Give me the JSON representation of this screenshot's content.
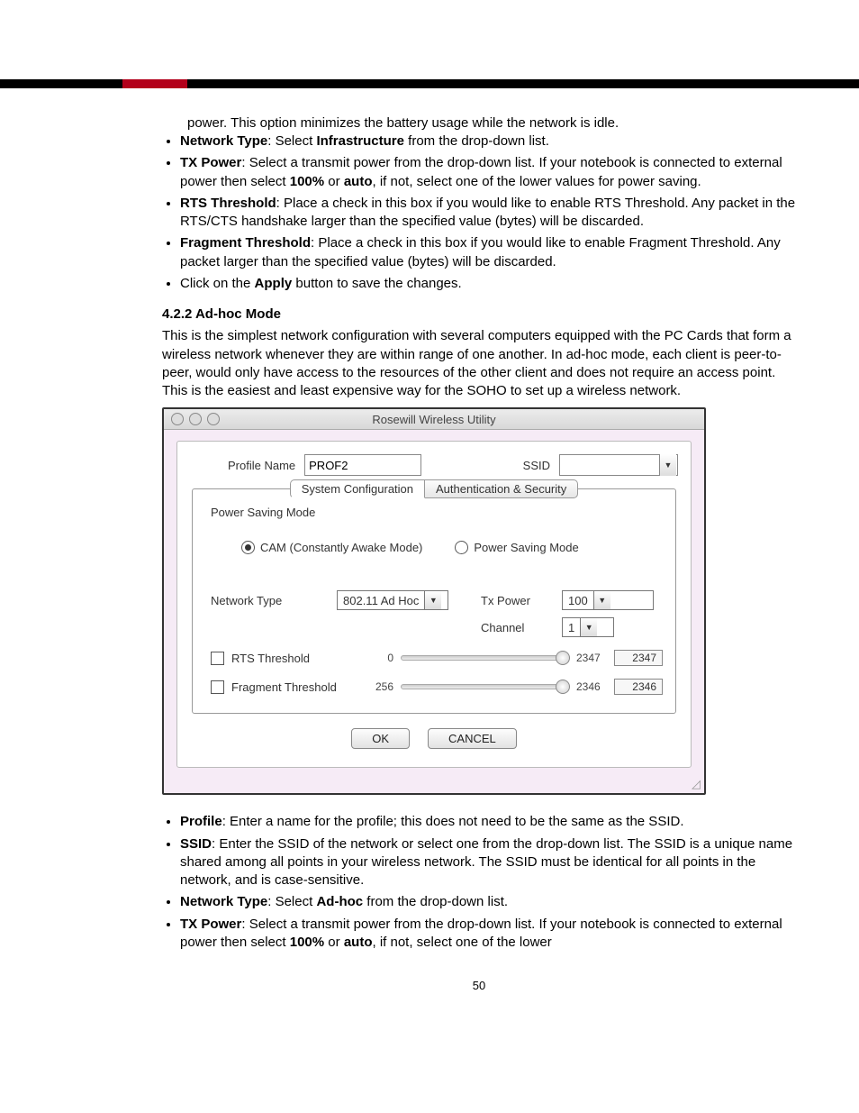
{
  "topText": {
    "powerLine": "power. This option minimizes the battery usage while the network is idle.",
    "bullets": [
      {
        "boldLead": "Network Type",
        "rest": ": Select ",
        "bold2": "Infrastructure",
        "tail": " from the drop-down list."
      },
      {
        "boldLead": "TX Power",
        "rest": ": Select a transmit power from the drop-down list. If your notebook is connected to external power then select ",
        "bold2": "100%",
        "mid": " or ",
        "bold3": "auto",
        "tail": ", if not, select one of the lower values for power saving."
      },
      {
        "boldLead": "RTS Threshold",
        "rest": ": Place a check in this box if you would like to enable RTS Threshold. Any packet in the RTS/CTS handshake larger than the specified value (bytes) will be discarded."
      },
      {
        "boldLead": "Fragment Threshold",
        "rest": ": Place a check in this box if you would like to enable Fragment Threshold. Any packet larger than the specified value (bytes) will be discarded."
      },
      {
        "plainLead": "Click on the ",
        "bold2": "Apply",
        "tail": " button to save the changes."
      }
    ]
  },
  "section": {
    "title": "4.2.2 Ad-hoc Mode",
    "para": "This is the simplest network configuration with several computers equipped with the PC Cards that form a wireless network whenever they are within range of one another.  In ad-hoc mode, each client is peer-to-peer, would only have access to the resources of the other client and does not require an access point. This is the easiest and least expensive way for the SOHO to set up a wireless network."
  },
  "shot": {
    "windowTitle": "Rosewill Wireless Utility",
    "profileNameLabel": "Profile Name",
    "profileNameValue": "PROF2",
    "ssidLabel": "SSID",
    "ssidValue": "",
    "tabs": {
      "sysconf": "System Configuration",
      "auth": "Authentication & Security"
    },
    "powerSavingHead": "Power Saving Mode",
    "radioCam": "CAM (Constantly Awake Mode)",
    "radioPsm": "Power Saving Mode",
    "networkTypeLabel": "Network Type",
    "networkTypeValue": "802.11 Ad Hoc",
    "txPowerLabel": "Tx Power",
    "txPowerValue": "100",
    "channelLabel": "Channel",
    "channelValue": "1",
    "rtsLabel": "RTS Threshold",
    "rtsMin": "0",
    "rtsMax": "2347",
    "rtsVal": "2347",
    "fragLabel": "Fragment Threshold",
    "fragMin": "256",
    "fragMax": "2346",
    "fragVal": "2346",
    "okBtn": "OK",
    "cancelBtn": "CANCEL"
  },
  "bottomBullets": [
    {
      "boldLead": "Profile",
      "rest": ": Enter a name for the profile; this does not need to be the same as the SSID."
    },
    {
      "boldLead": "SSID",
      "rest": ": Enter the SSID of the network or select one from the drop-down list. The SSID is a unique name shared among all points in your wireless network. The SSID must be identical for all points in the network, and is case-sensitive."
    },
    {
      "boldLead": "Network Type",
      "rest": ": Select ",
      "bold2": "Ad-hoc",
      "tail": " from the drop-down list."
    },
    {
      "boldLead": "TX Power",
      "rest": ": Select a transmit power from the drop-down list. If your notebook is connected to external power then select ",
      "bold2": "100%",
      "mid": " or ",
      "bold3": "auto",
      "tail": ", if not, select one of the lower"
    }
  ],
  "pageNumber": "50"
}
